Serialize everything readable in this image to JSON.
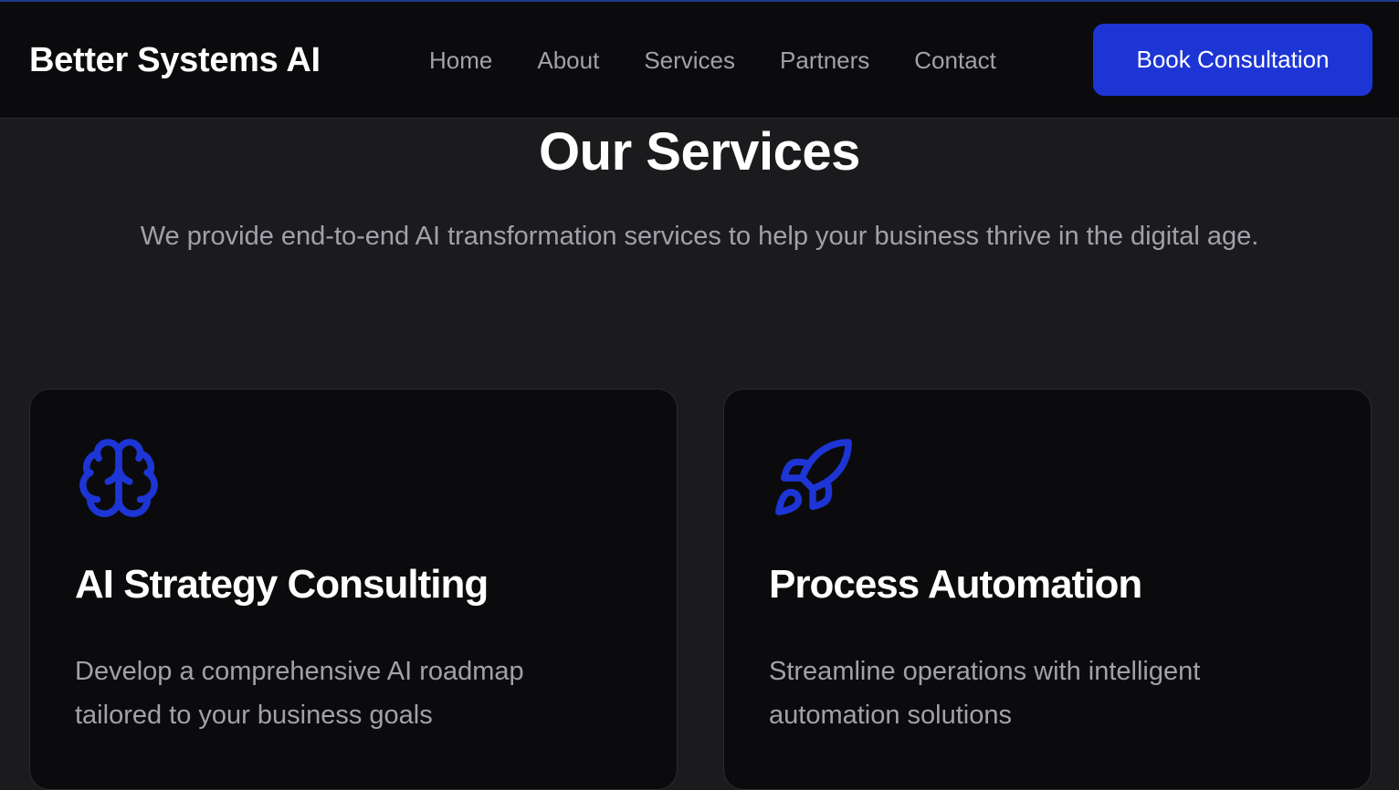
{
  "brand": {
    "name": "Better Systems AI"
  },
  "nav": {
    "items": [
      "Home",
      "About",
      "Services",
      "Partners",
      "Contact"
    ],
    "cta_label": "Book Consultation"
  },
  "section": {
    "title": "Our Services",
    "subtitle": "We provide end-to-end AI transformation services to help your business thrive in the digital age."
  },
  "services": [
    {
      "icon": "brain-icon",
      "title": "AI Strategy Consulting",
      "description": "Develop a comprehensive AI roadmap tailored to your business goals"
    },
    {
      "icon": "rocket-icon",
      "title": "Process Automation",
      "description": "Streamline operations with intelligent automation solutions"
    }
  ],
  "colors": {
    "accent": "#1d35d5",
    "background": "#1b1b1e",
    "card": "#0b0b0d",
    "muted_text": "#a1a1aa"
  }
}
